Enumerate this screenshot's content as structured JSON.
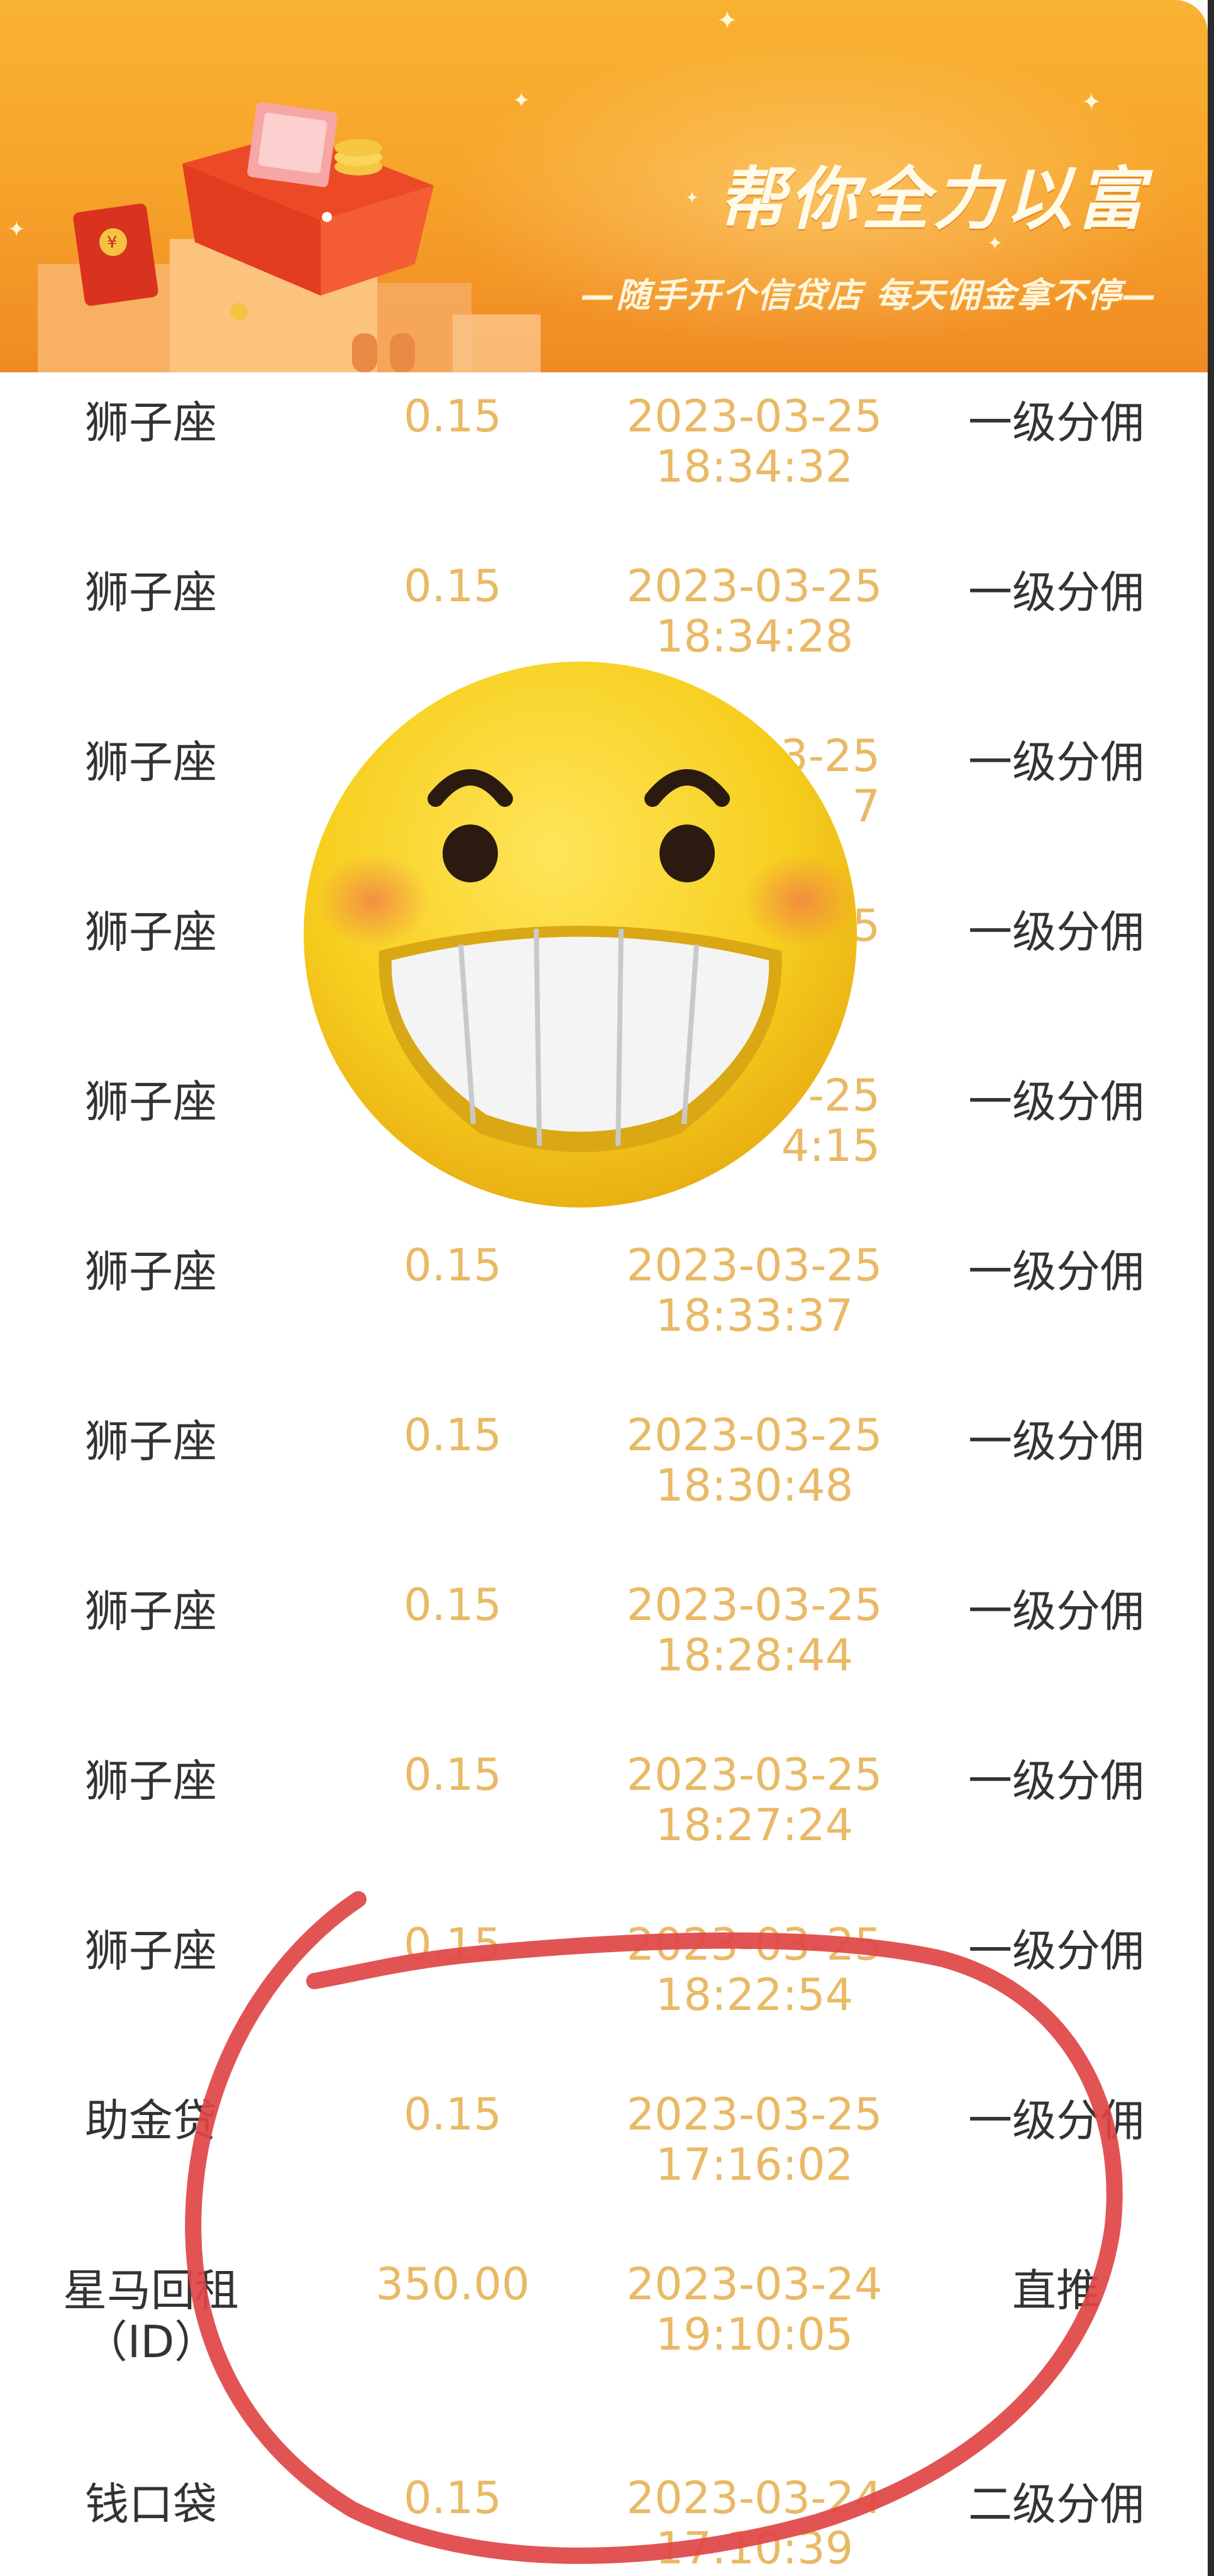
{
  "banner": {
    "title": "帮你全力以富",
    "subtitle": "—随手开个信贷店 每天佣金拿不停—"
  },
  "records": [
    {
      "name": "狮子座",
      "amount": "0.15",
      "date": "2023-03-25",
      "time": "18:34:32",
      "type": "一级分佣"
    },
    {
      "name": "狮子座",
      "amount": "0.15",
      "date": "2023-03-25",
      "time": "18:34:28",
      "type": "一级分佣"
    },
    {
      "name": "狮子座",
      "amount": "",
      "date": "3-25",
      "time": "7",
      "type": "一级分佣"
    },
    {
      "name": "狮子座",
      "amount": "",
      "date": "5",
      "time": "",
      "type": "一级分佣"
    },
    {
      "name": "狮子座",
      "amount": "",
      "date": "-25",
      "time": "4:15",
      "type": "一级分佣"
    },
    {
      "name": "狮子座",
      "amount": "0.15",
      "date": "2023-03-25",
      "time": "18:33:37",
      "type": "一级分佣"
    },
    {
      "name": "狮子座",
      "amount": "0.15",
      "date": "2023-03-25",
      "time": "18:30:48",
      "type": "一级分佣"
    },
    {
      "name": "狮子座",
      "amount": "0.15",
      "date": "2023-03-25",
      "time": "18:28:44",
      "type": "一级分佣"
    },
    {
      "name": "狮子座",
      "amount": "0.15",
      "date": "2023-03-25",
      "time": "18:27:24",
      "type": "一级分佣"
    },
    {
      "name": "狮子座",
      "amount": "0.15",
      "date": "2023-03-25",
      "time": "18:22:54",
      "type": "一级分佣"
    },
    {
      "name": "助金贷",
      "amount": "0.15",
      "date": "2023-03-25",
      "time": "17:16:02",
      "type": "一级分佣"
    },
    {
      "name": "星马回租",
      "name_line2": "（ID）",
      "amount": "350.00",
      "date": "2023-03-24",
      "time": "19:10:05",
      "type": "直推"
    },
    {
      "name": "钱口袋",
      "amount": "0.15",
      "date": "2023-03-24",
      "time": "17:10:39",
      "type": "二级分佣"
    }
  ],
  "colors": {
    "banner_orange": "#f7a52a",
    "amount_gold": "#e9b965",
    "text_dark": "#333333",
    "annotation_red": "#e04545"
  },
  "icons": [
    "gift-box-icon",
    "red-envelope-icon",
    "grinning-emoji-icon"
  ]
}
